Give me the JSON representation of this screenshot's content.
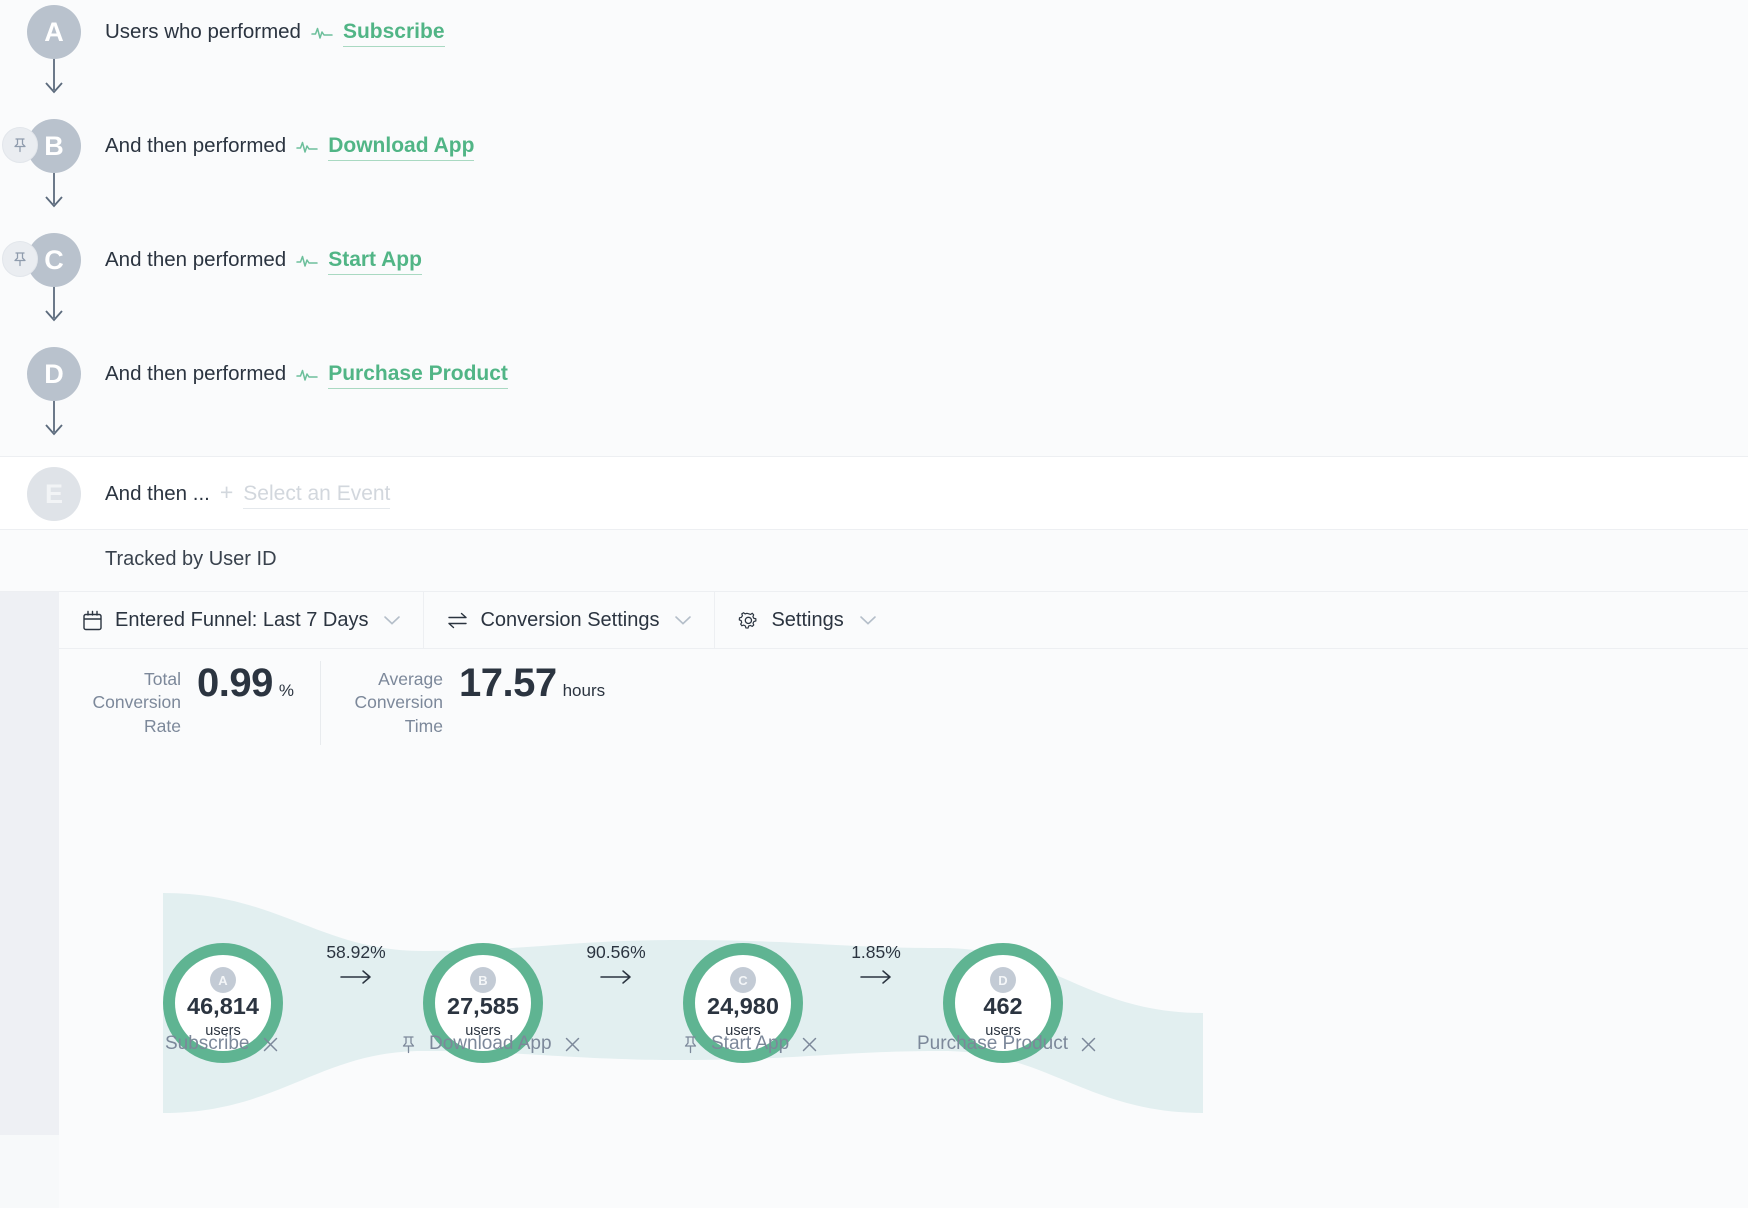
{
  "colors": {
    "accent_green": "#5fb492",
    "link_green": "#51b586",
    "badge_grey": "#b9c2cd",
    "band_teal": "#e2eff0",
    "text_dark": "#2b3440",
    "text_muted": "#7c889a",
    "gutter": "#eef0f4"
  },
  "builder": {
    "steps": [
      {
        "letter": "A",
        "prefix": "Users who performed",
        "event": "Subscribe",
        "pinned": false,
        "icon": "pulse-icon"
      },
      {
        "letter": "B",
        "prefix": "And then performed",
        "event": "Download App",
        "pinned": true,
        "icon": "pulse-icon"
      },
      {
        "letter": "C",
        "prefix": "And then performed",
        "event": "Start App",
        "pinned": true,
        "icon": "pulse-icon"
      },
      {
        "letter": "D",
        "prefix": "And then performed",
        "event": "Purchase Product",
        "pinned": false,
        "icon": "pulse-icon"
      }
    ],
    "add_step": {
      "letter": "E",
      "prefix": "And then ...",
      "plus": "+",
      "placeholder": "Select an Event"
    },
    "tracked_by": "Tracked by User ID"
  },
  "toolbar": {
    "items": [
      {
        "icon": "calendar-icon",
        "label": "Entered Funnel: Last 7 Days",
        "caret": true
      },
      {
        "icon": "conversion-arrows-icon",
        "label": "Conversion Settings",
        "caret": true
      },
      {
        "icon": "gear-icon",
        "label": "Settings",
        "caret": true
      }
    ]
  },
  "metrics": [
    {
      "caption": "Total Conversion Rate",
      "value": "0.99",
      "unit": "%"
    },
    {
      "caption": "Average Conversion Time",
      "value": "17.57",
      "unit": "hours"
    }
  ],
  "chart_data": {
    "type": "bar",
    "title": "",
    "xlabel": "",
    "ylabel": "users",
    "categories": [
      "Subscribe",
      "Download App",
      "Start App",
      "Purchase Product"
    ],
    "values": [
      46814,
      27585,
      24980,
      462
    ],
    "value_labels": [
      "46,814",
      "27,585",
      "24,980",
      "462"
    ],
    "letters": [
      "A",
      "B",
      "C",
      "D"
    ],
    "unit_label": "users",
    "pinned": [
      false,
      true,
      true,
      false
    ],
    "step_conversions": [
      "58.92%",
      "90.56%",
      "1.85%"
    ],
    "step_conversion_values": [
      58.92,
      90.56,
      1.85
    ],
    "total_conversion_rate": 0.99,
    "average_conversion_time_hours": 17.57,
    "grid": false,
    "legend": "none"
  }
}
